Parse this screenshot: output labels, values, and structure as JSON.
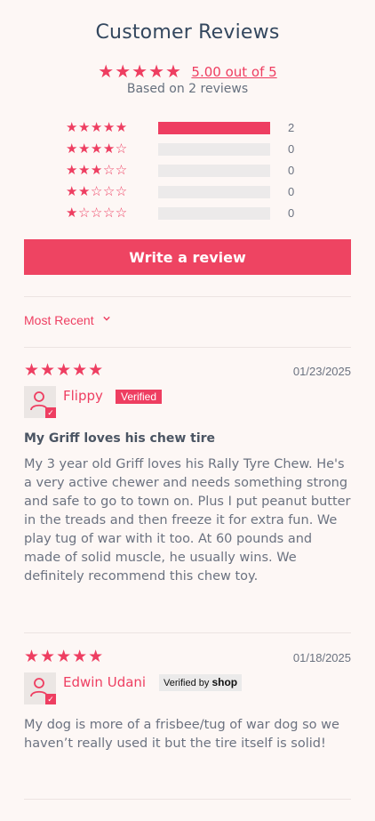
{
  "header": {
    "title": "Customer Reviews",
    "stars": "★★★★★",
    "average_label": "5.00 out of 5",
    "average_value": 5.0,
    "based_on": "Based on 2 reviews"
  },
  "histogram": [
    {
      "stars": "★★★★★",
      "count": "2",
      "fraction": 1.0
    },
    {
      "stars": "★★★★☆",
      "count": "0",
      "fraction": 0
    },
    {
      "stars": "★★★☆☆",
      "count": "0",
      "fraction": 0
    },
    {
      "stars": "★★☆☆☆",
      "count": "0",
      "fraction": 0
    },
    {
      "stars": "★☆☆☆☆",
      "count": "0",
      "fraction": 0
    }
  ],
  "write_review_label": "Write a review",
  "sort": {
    "selected": "Most Recent"
  },
  "reviews": [
    {
      "rating_stars": "★★★★★",
      "rating": 5,
      "date": "01/23/2025",
      "author": "Flippy",
      "badge": "Verified",
      "title": "My Griff loves his chew tire",
      "body": "My 3 year old Griff loves his Rally Tyre Chew. He's a very active chewer and needs something strong and safe to go to town on. Plus I put peanut butter in the treads and then freeze it for extra fun. We play tug of war with it too. At 60 pounds and made of solid muscle, he usually wins. We definitely recommend this chew toy."
    },
    {
      "rating_stars": "★★★★★",
      "rating": 5,
      "date": "01/18/2025",
      "author": "Edwin Udani",
      "badge_prefix": "Verified by",
      "badge_brand": "shop",
      "body": "My dog is more of a frisbee/tug of war dog so we haven’t really used it but the tire itself is solid!"
    }
  ],
  "colors": {
    "accent": "#ee3e61",
    "background": "#fdf7f5",
    "title": "#33475e"
  }
}
